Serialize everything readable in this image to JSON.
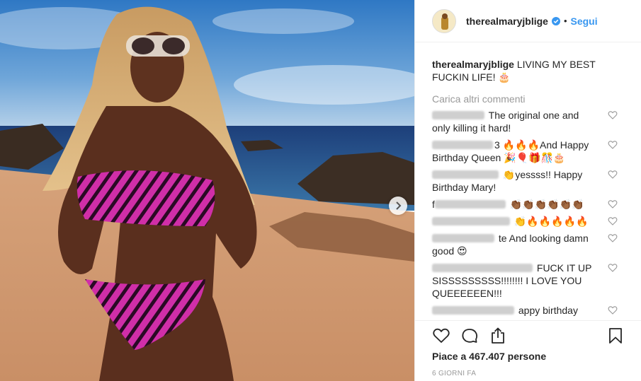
{
  "post": {
    "username": "therealmaryjblige",
    "follow_label": "Segui",
    "dot": "•",
    "caption_user": "therealmaryjblige",
    "caption_text": "LIVING MY BEST FUCKIN LIFE! 🎂",
    "load_more": "Carica altri commenti",
    "likes": "Piace a 467.407 persone",
    "time": "6 GIORNI FA"
  },
  "comments": [
    {
      "text": "The original one and only killing it hard!"
    },
    {
      "text": "🔥🔥🔥And Happy Birthday Queen 🎉🎈🎁🎊🎂",
      "suffix": "3"
    },
    {
      "text": "👏yessss!! Happy Birthday Mary!"
    },
    {
      "text": "👏🏾👏🏾👏🏾👏🏾👏🏾👏🏾",
      "prefix": "f"
    },
    {
      "text": "👏🔥🔥🔥🔥🔥"
    },
    {
      "text": "te And looking damn good 😍"
    },
    {
      "text": "FUCK IT UP SISSSSSSSSS!!!!!!!! I LOVE YOU QUEEEEEEN!!!"
    },
    {
      "text": "appy birthday"
    }
  ],
  "icons": {
    "verified": "verified-badge-icon",
    "next": "chevron-right-icon",
    "like": "heart-icon",
    "comment": "comment-bubble-icon",
    "share": "share-icon",
    "save": "bookmark-icon"
  },
  "colors": {
    "link": "#3897f0",
    "muted": "#999999",
    "text": "#262626",
    "border": "#efefef"
  }
}
